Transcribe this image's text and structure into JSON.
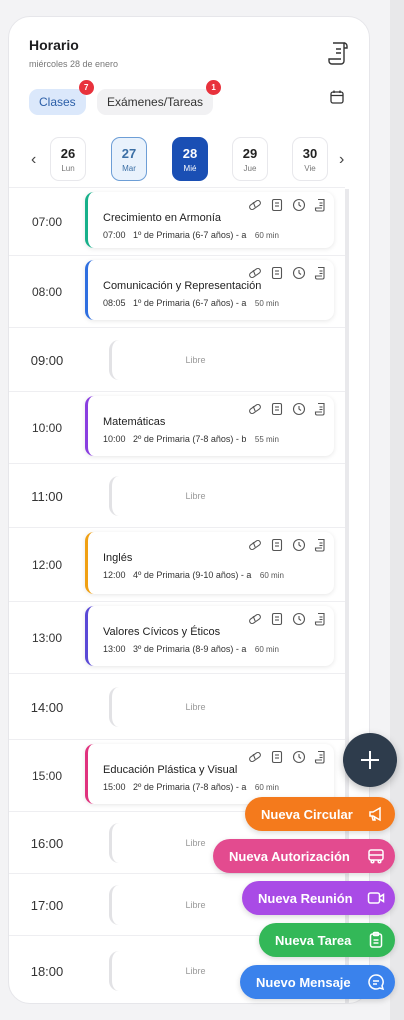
{
  "header": {
    "title": "Horario",
    "date": "miércoles 28 de enero"
  },
  "tabs": [
    {
      "label": "Clases",
      "badge": "7"
    },
    {
      "label": "Exámenes/Tareas",
      "badge": "1"
    }
  ],
  "days": [
    {
      "num": "26",
      "wd": "Lun"
    },
    {
      "num": "27",
      "wd": "Mar"
    },
    {
      "num": "28",
      "wd": "Mié"
    },
    {
      "num": "29",
      "wd": "Jue"
    },
    {
      "num": "30",
      "wd": "Vie"
    }
  ],
  "nav": {
    "prev": "‹",
    "next": "›"
  },
  "slots": [
    {
      "time": "07:00",
      "name": "Crecimiento en Armonía",
      "start": "07:00",
      "group": "1º de Primaria (6-7 años) - a",
      "duration": "60 min",
      "color": "#17b08a"
    },
    {
      "time": "08:00",
      "name": "Comunicación y Representación",
      "start": "08:05",
      "group": "1º de Primaria (6-7 años) - a",
      "duration": "50 min",
      "color": "#2f6fe0"
    },
    {
      "time": "09:00",
      "free": "Libre"
    },
    {
      "time": "10:00",
      "name": "Matemáticas",
      "start": "10:00",
      "group": "2º de Primaria (7-8 años) - b",
      "duration": "55 min",
      "color": "#8a3ee0"
    },
    {
      "time": "11:00",
      "free": "Libre"
    },
    {
      "time": "12:00",
      "name": "Inglés",
      "start": "12:00",
      "group": "4º de Primaria (9-10 años) - a",
      "duration": "60 min",
      "color": "#f0a013"
    },
    {
      "time": "13:00",
      "name": "Valores Cívicos y Éticos",
      "start": "13:00",
      "group": "3º de Primaria (8-9 años) - a",
      "duration": "60 min",
      "color": "#5a49d6"
    },
    {
      "time": "14:00",
      "free": "Libre"
    },
    {
      "time": "15:00",
      "name": "Educación Plástica y Visual",
      "start": "15:00",
      "group": "2º de Primaria (7-8 años) - a",
      "duration": "60 min",
      "color": "#e0327e"
    },
    {
      "time": "16:00",
      "free": "Libre"
    },
    {
      "time": "17:00",
      "free": "Libre"
    },
    {
      "time": "18:00",
      "free": "Libre"
    }
  ],
  "actions": [
    {
      "label": "Nueva Circular",
      "color": "#f47a1c",
      "icon": "megaphone-icon"
    },
    {
      "label": "Nueva Autorización",
      "color": "#e34b8f",
      "icon": "bus-icon"
    },
    {
      "label": "Nueva Reunión",
      "color": "#a94be6",
      "icon": "video-icon"
    },
    {
      "label": "Nueva Tarea",
      "color": "#33b858",
      "icon": "clipboard-icon"
    },
    {
      "label": "Nuevo Mensaje",
      "color": "#3a82ec",
      "icon": "chat-icon"
    }
  ]
}
